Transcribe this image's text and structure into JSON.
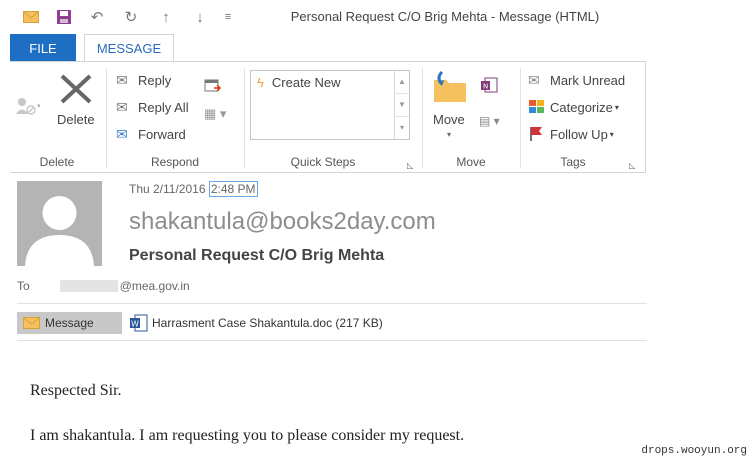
{
  "window": {
    "title": "Personal Request C/O Brig Mehta - Message (HTML)"
  },
  "tabs": {
    "file": "FILE",
    "message": "MESSAGE"
  },
  "ribbon": {
    "delete_group": {
      "delete": "Delete",
      "label": "Delete"
    },
    "respond_group": {
      "reply": "Reply",
      "reply_all": "Reply All",
      "forward": "Forward",
      "label": "Respond"
    },
    "quick_steps": {
      "create_new": "Create New",
      "label": "Quick Steps"
    },
    "move_group": {
      "move": "Move",
      "label": "Move"
    },
    "tags_group": {
      "mark_unread": "Mark Unread",
      "categorize": "Categorize",
      "follow_up": "Follow Up",
      "label": "Tags"
    }
  },
  "message": {
    "date": "Thu 2/11/2016",
    "time": "2:48 PM",
    "sender": "shakantula@books2day.com",
    "subject": "Personal Request C/O Brig Mehta",
    "to_label": "To",
    "to_address": "@mea.gov.in",
    "attachments": {
      "message_tab": "Message",
      "file": "Harrasment Case Shakantula.doc (217 KB)"
    },
    "body": [
      "Respected Sir.",
      "I am shakantula. I am requesting you to please consider my request."
    ]
  },
  "watermark": "drops.wooyun.org",
  "colors": {
    "accent": "#1e6fc4",
    "follow_up_flag": "#d13438"
  }
}
